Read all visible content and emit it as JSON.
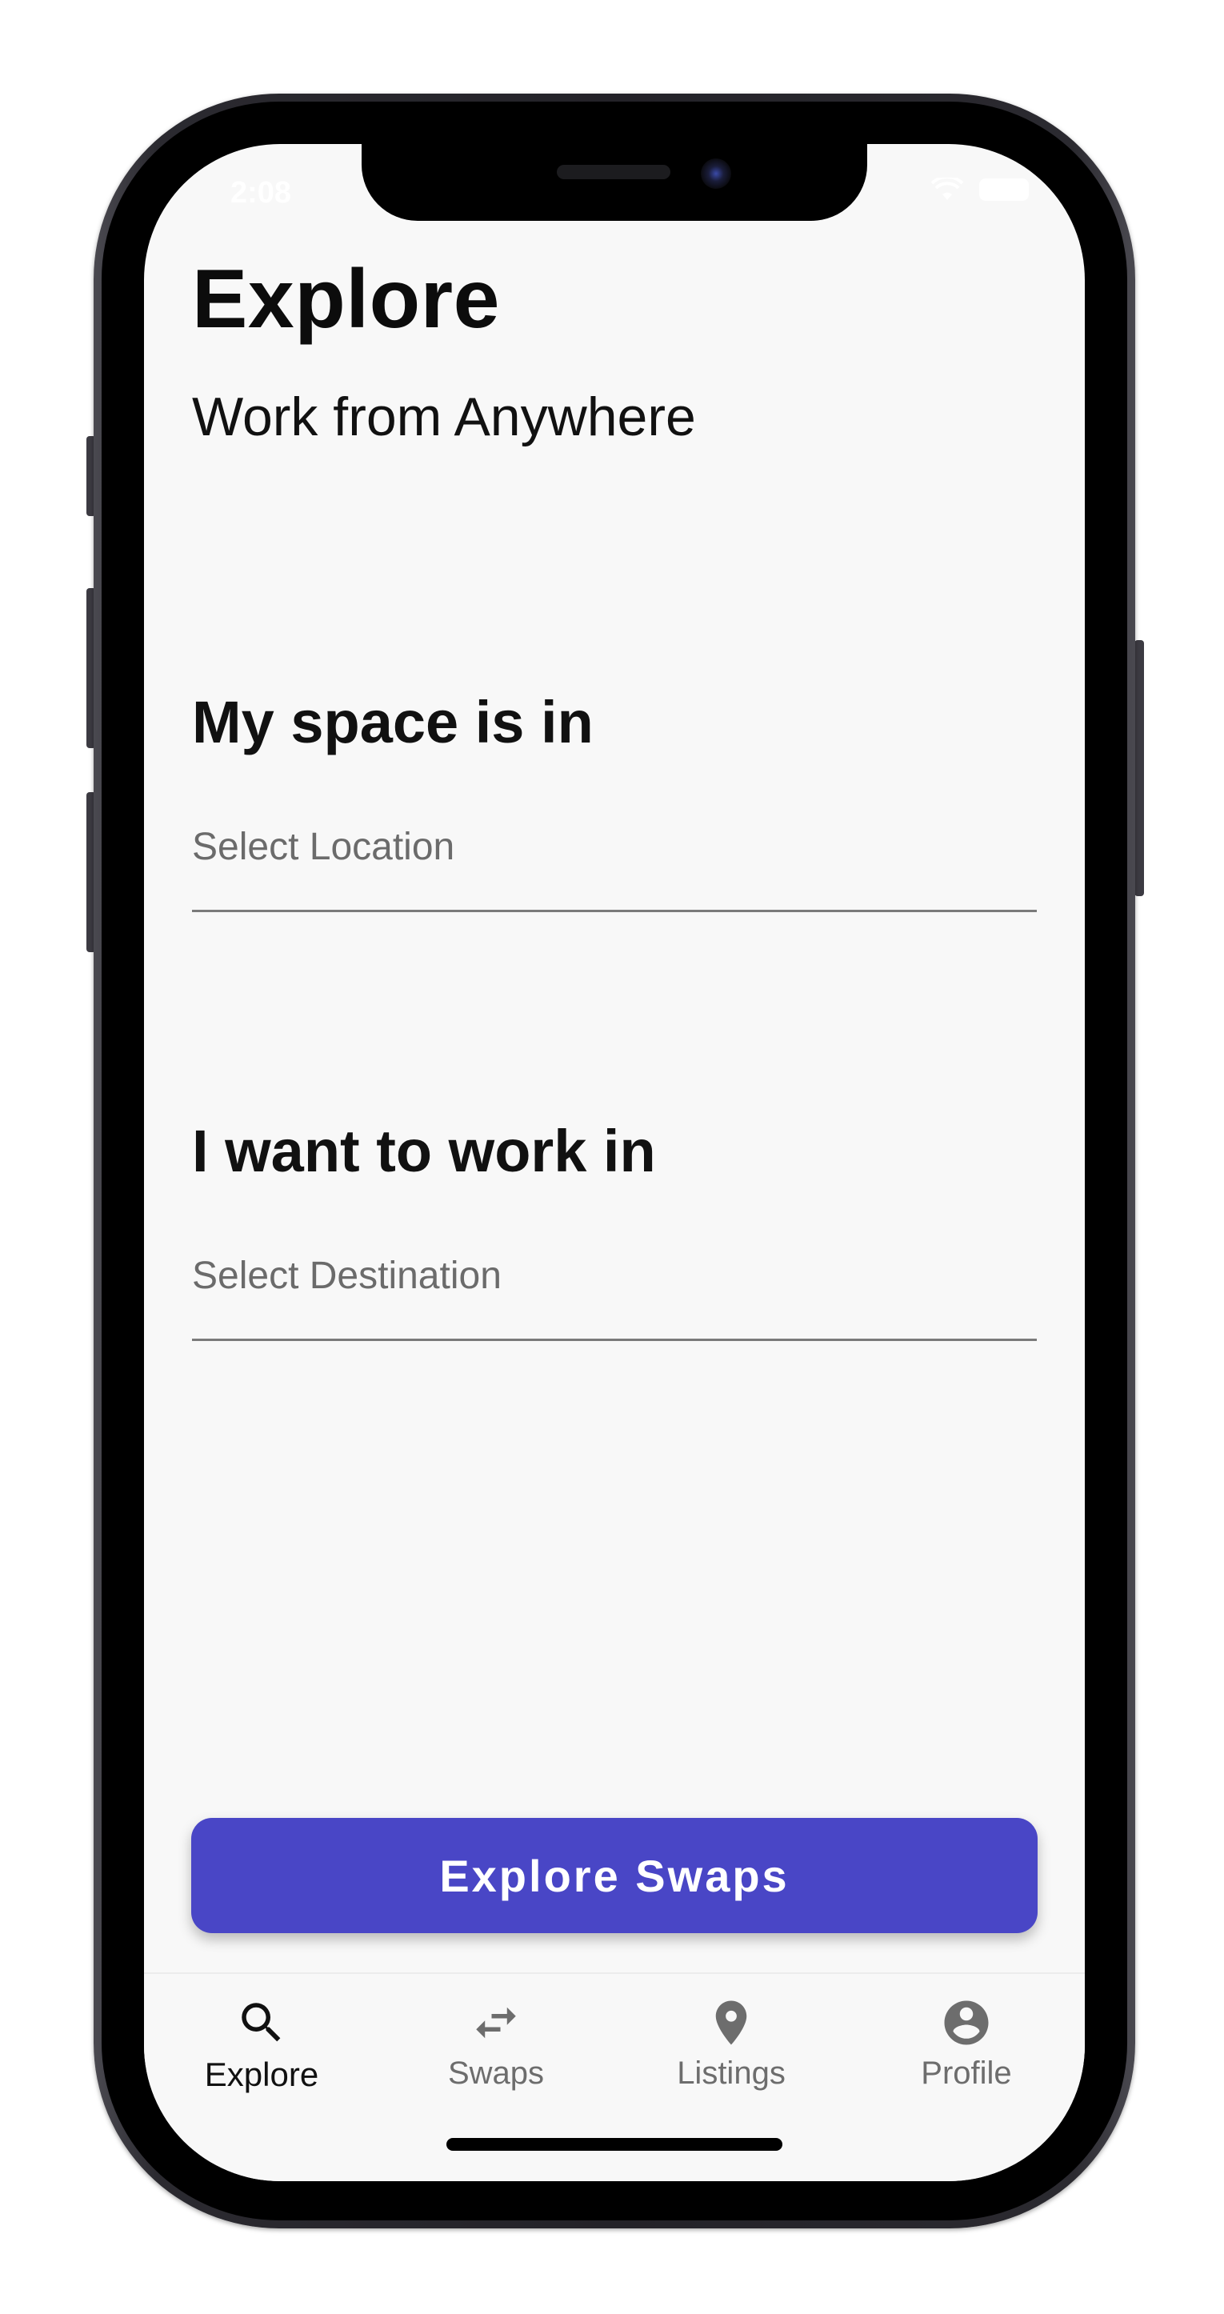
{
  "status_bar": {
    "time": "2:08"
  },
  "page": {
    "title": "Explore",
    "subtitle": "Work from Anywhere"
  },
  "form": {
    "origin_label": "My space is in",
    "origin_placeholder": "Select Location",
    "destination_label": "I want to work in",
    "destination_placeholder": "Select Destination",
    "submit_label": "Explore Swaps"
  },
  "tab_bar": {
    "items": [
      {
        "label": "Explore",
        "icon": "search-icon",
        "active": true
      },
      {
        "label": "Swaps",
        "icon": "swap-arrows-icon",
        "active": false
      },
      {
        "label": "Listings",
        "icon": "location-pin-icon",
        "active": false
      },
      {
        "label": "Profile",
        "icon": "account-circle-icon",
        "active": false
      }
    ]
  },
  "colors": {
    "accent": "#4946c6",
    "background": "#f8f8f8",
    "active_tab": "#111111",
    "inactive_tab": "#6d6d6d"
  }
}
